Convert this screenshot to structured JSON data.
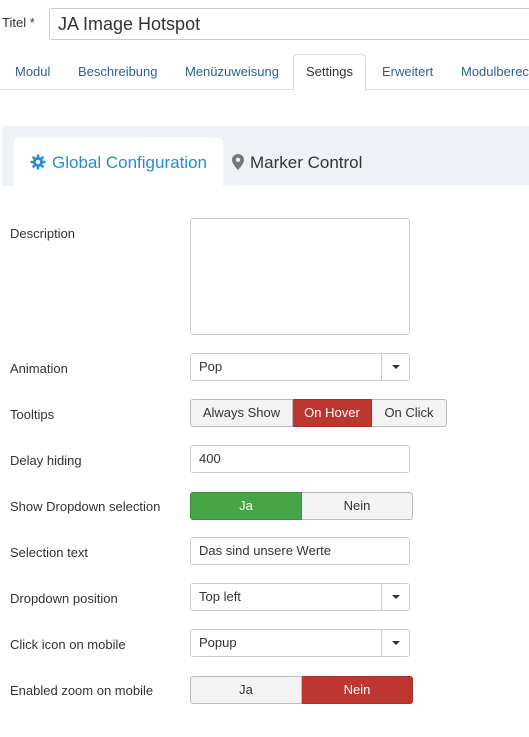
{
  "header": {
    "title_label": "Titel *",
    "title_value": "JA Image Hotspot"
  },
  "tabs": [
    {
      "label": "Modul",
      "active": false
    },
    {
      "label": "Beschreibung",
      "active": false
    },
    {
      "label": "Menüzuweisung",
      "active": false
    },
    {
      "label": "Settings",
      "active": true
    },
    {
      "label": "Erweitert",
      "active": false
    },
    {
      "label": "Modulberec",
      "active": false
    }
  ],
  "subtabs": [
    {
      "label": "Global Configuration",
      "icon": "gear-icon",
      "active": true
    },
    {
      "label": "Marker Control",
      "icon": "map-marker-icon",
      "active": false
    }
  ],
  "form": {
    "description": {
      "label": "Description",
      "value": ""
    },
    "animation": {
      "label": "Animation",
      "value": "Pop"
    },
    "tooltips": {
      "label": "Tooltips",
      "options": [
        "Always Show",
        "On Hover",
        "On Click"
      ],
      "selected": "On Hover"
    },
    "delay_hiding": {
      "label": "Delay hiding",
      "value": "400"
    },
    "show_dropdown": {
      "label": "Show Dropdown selection",
      "options": [
        "Ja",
        "Nein"
      ],
      "selected": "Ja"
    },
    "selection_text": {
      "label": "Selection text",
      "value": "Das sind unsere Werte"
    },
    "dropdown_position": {
      "label": "Dropdown position",
      "value": "Top left"
    },
    "click_icon_mobile": {
      "label": "Click icon on mobile",
      "value": "Popup"
    },
    "zoom_mobile": {
      "label": "Enabled zoom on mobile",
      "options": [
        "Ja",
        "Nein"
      ],
      "selected": "Nein"
    }
  },
  "colors": {
    "accent_blue": "#2a8ad4",
    "link_blue": "#2a6496",
    "active_red": "#bd362f",
    "active_green": "#46a546",
    "panel_bg": "#eef2f6"
  }
}
